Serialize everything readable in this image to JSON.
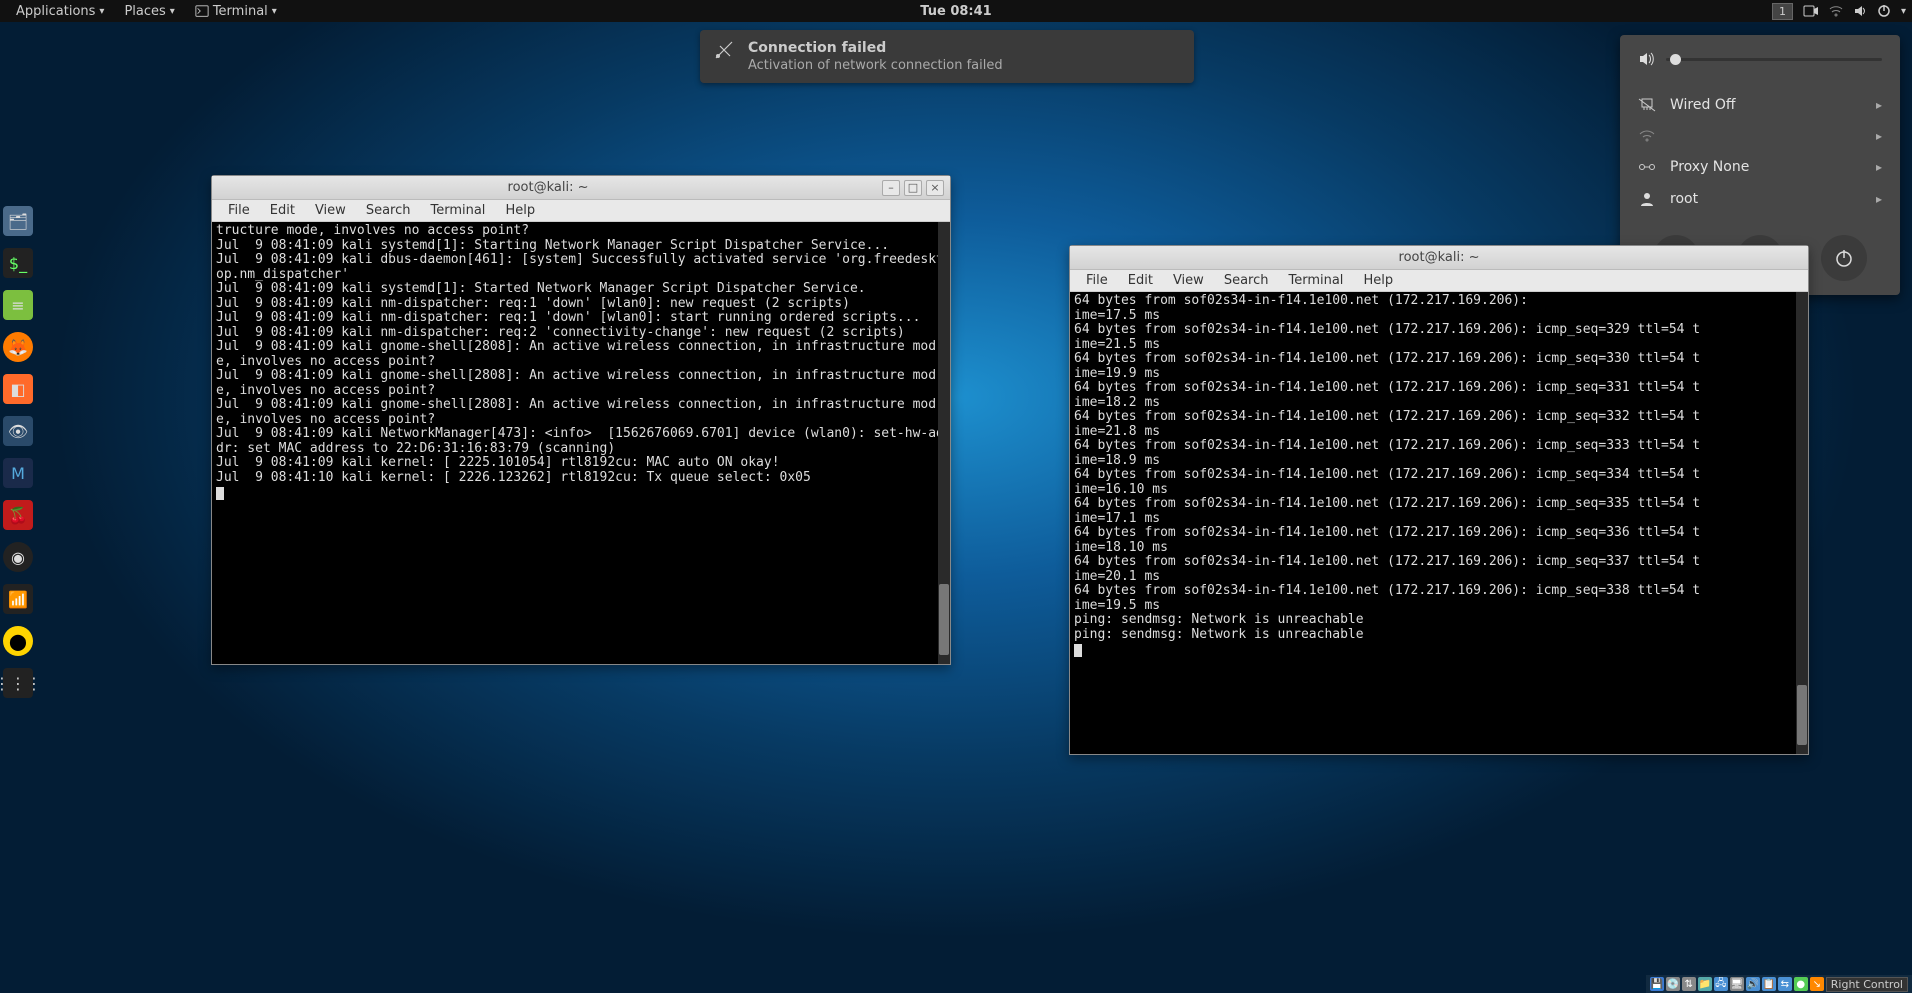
{
  "top_panel": {
    "applications": "Applications",
    "places": "Places",
    "app_indicator": "Terminal",
    "clock": "Tue 08:41",
    "workspace_number": "1"
  },
  "notification": {
    "title": "Connection failed",
    "body": "Activation of network connection failed"
  },
  "system_menu": {
    "wired": "Wired Off",
    "proxy": "Proxy None",
    "user": "root"
  },
  "terminal_menubar": [
    "File",
    "Edit",
    "View",
    "Search",
    "Terminal",
    "Help"
  ],
  "window1": {
    "title": "root@kali: ~",
    "content": "tructure mode, involves no access point?\nJul  9 08:41:09 kali systemd[1]: Starting Network Manager Script Dispatcher Service...\nJul  9 08:41:09 kali dbus-daemon[461]: [system] Successfully activated service 'org.freedesktop.nm_dispatcher'\nJul  9 08:41:09 kali systemd[1]: Started Network Manager Script Dispatcher Service.\nJul  9 08:41:09 kali nm-dispatcher: req:1 'down' [wlan0]: new request (2 scripts)\nJul  9 08:41:09 kali nm-dispatcher: req:1 'down' [wlan0]: start running ordered scripts...\nJul  9 08:41:09 kali nm-dispatcher: req:2 'connectivity-change': new request (2 scripts)\nJul  9 08:41:09 kali gnome-shell[2808]: An active wireless connection, in infrastructure mode, involves no access point?\nJul  9 08:41:09 kali gnome-shell[2808]: An active wireless connection, in infrastructure mode, involves no access point?\nJul  9 08:41:09 kali gnome-shell[2808]: An active wireless connection, in infrastructure mode, involves no access point?\nJul  9 08:41:09 kali NetworkManager[473]: <info>  [1562676069.6701] device (wlan0): set-hw-addr: set MAC address to 22:D6:31:16:83:79 (scanning)\nJul  9 08:41:09 kali kernel: [ 2225.101054] rtl8192cu: MAC auto ON okay!\nJul  9 08:41:10 kali kernel: [ 2226.123262] rtl8192cu: Tx queue select: 0x05\n"
  },
  "window2": {
    "title": "root@kali: ~",
    "content": "64 bytes from sof02s34-in-f14.1e100.net (172.217.169.206):\nime=17.5 ms\n64 bytes from sof02s34-in-f14.1e100.net (172.217.169.206): icmp_seq=329 ttl=54 t\nime=21.5 ms\n64 bytes from sof02s34-in-f14.1e100.net (172.217.169.206): icmp_seq=330 ttl=54 t\nime=19.9 ms\n64 bytes from sof02s34-in-f14.1e100.net (172.217.169.206): icmp_seq=331 ttl=54 t\nime=18.2 ms\n64 bytes from sof02s34-in-f14.1e100.net (172.217.169.206): icmp_seq=332 ttl=54 t\nime=21.8 ms\n64 bytes from sof02s34-in-f14.1e100.net (172.217.169.206): icmp_seq=333 ttl=54 t\nime=18.9 ms\n64 bytes from sof02s34-in-f14.1e100.net (172.217.169.206): icmp_seq=334 ttl=54 t\nime=16.10 ms\n64 bytes from sof02s34-in-f14.1e100.net (172.217.169.206): icmp_seq=335 ttl=54 t\nime=17.1 ms\n64 bytes from sof02s34-in-f14.1e100.net (172.217.169.206): icmp_seq=336 ttl=54 t\nime=18.10 ms\n64 bytes from sof02s34-in-f14.1e100.net (172.217.169.206): icmp_seq=337 ttl=54 t\nime=20.1 ms\n64 bytes from sof02s34-in-f14.1e100.net (172.217.169.206): icmp_seq=338 ttl=54 t\nime=19.5 ms\nping: sendmsg: Network is unreachable\nping: sendmsg: Network is unreachable\n"
  },
  "bottom_bar": {
    "right_control": "Right Control"
  }
}
